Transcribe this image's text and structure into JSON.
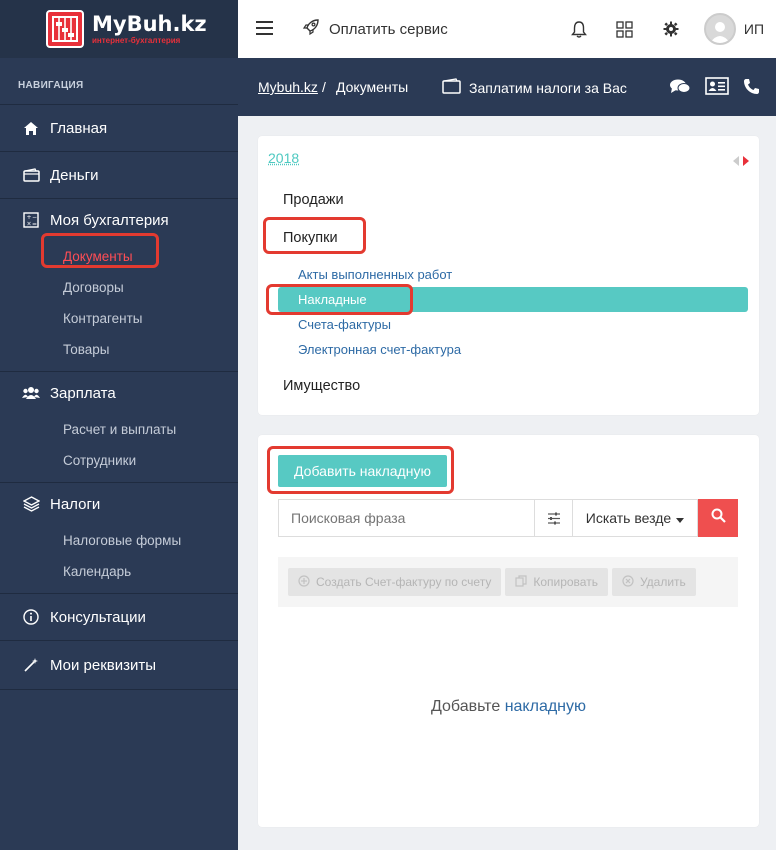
{
  "brand": {
    "name": "MyBuh.kz",
    "tagline": "интернет-бухгалтерия",
    "color": "#e8303a"
  },
  "sidebar": {
    "heading": "НАВИГАЦИЯ",
    "items": [
      {
        "label": "Главная",
        "icon": "home-icon"
      },
      {
        "label": "Деньги",
        "icon": "wallet-icon"
      },
      {
        "label": "Моя бухгалтерия",
        "icon": "calculator-icon",
        "sub": [
          "Документы",
          "Договоры",
          "Контрагенты",
          "Товары"
        ]
      },
      {
        "label": "Зарплата",
        "icon": "users-icon",
        "sub": [
          "Расчет и выплаты",
          "Сотрудники"
        ]
      },
      {
        "label": "Налоги",
        "icon": "layers-icon",
        "sub": [
          "Налоговые формы",
          "Календарь"
        ]
      },
      {
        "label": "Консультации",
        "icon": "info-icon"
      },
      {
        "label": "Мои реквизиты",
        "icon": "magic-wand-icon"
      }
    ],
    "active_sub": "Документы"
  },
  "topbar": {
    "pay_service": "Оплатить сервис",
    "user_initials": "ИП"
  },
  "breadcrumb": {
    "home": "Mybuh.kz",
    "separator": "/",
    "current": "Документы",
    "tax_link": "Заплатим налоги за Вас"
  },
  "documents_nav": {
    "year": "2018",
    "sales": "Продажи",
    "purchases": "Покупки",
    "purchase_items": [
      "Акты выполненных работ",
      "Накладные",
      "Счета-фактуры",
      "Электронная счет-фактура"
    ],
    "active": "Накладные",
    "property": "Имущество"
  },
  "list": {
    "add_button": "Добавить накладную",
    "search_placeholder": "Поисковая фраза",
    "scope": "Искать везде",
    "toolbar": {
      "create_invoice": "Создать Счет-фактуру по счету",
      "copy": "Копировать",
      "delete": "Удалить"
    },
    "empty_prefix": "Добавьте",
    "empty_link": "накладную"
  },
  "colors": {
    "accent": "#57c9c3",
    "sidebar": "#2b3a55",
    "danger": "#ef4f4f",
    "highlight": "#e33a30"
  }
}
